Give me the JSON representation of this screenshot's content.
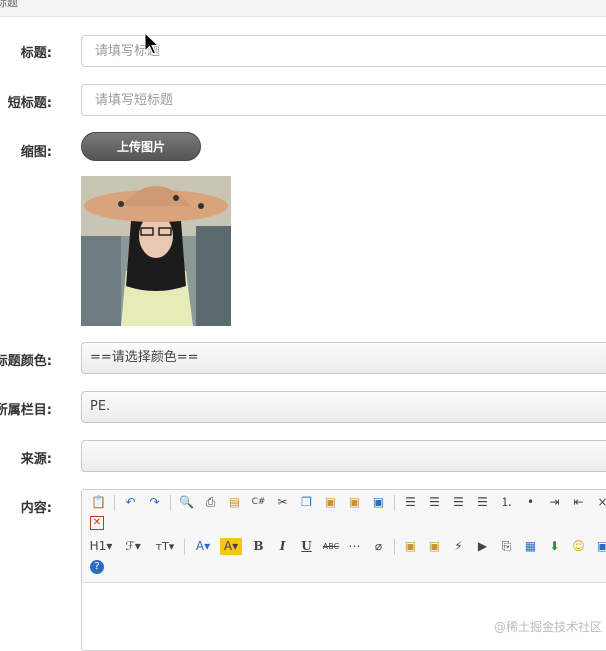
{
  "header": {
    "partial_text": "标题"
  },
  "form": {
    "title": {
      "label": "标题:",
      "placeholder": "请填写标题"
    },
    "short_title": {
      "label": "短标题:",
      "placeholder": "请填写短标题"
    },
    "thumbnail": {
      "label": "缩图:",
      "upload_label": "上传图片"
    },
    "title_color": {
      "label": "标题颜色:",
      "value": "==请选择颜色=="
    },
    "category": {
      "label": "所属栏目:",
      "value": "PE."
    },
    "source": {
      "label": "来源:",
      "value": ""
    },
    "content": {
      "label": "内容:"
    }
  },
  "editor": {
    "icons": [
      "paste-icon",
      "undo-icon",
      "redo-icon",
      "preview-icon",
      "print-icon",
      "template-icon",
      "code-icon",
      "cut-icon",
      "copy-icon",
      "paste-text-icon",
      "paste-word-icon",
      "paste-plain-icon",
      "align-left-icon",
      "align-center-icon",
      "align-right-icon",
      "justify-icon",
      "ordered-list-icon",
      "unordered-list-icon",
      "indent-icon",
      "outdent-icon",
      "fullscreen-icon",
      "heading-icon",
      "font-family-icon",
      "font-size-icon",
      "font-color-icon",
      "highlight-icon",
      "bold-icon",
      "italic-icon",
      "underline-icon",
      "strikethrough-icon",
      "hr-icon",
      "clear-format-icon",
      "image-icon",
      "multi-image-icon",
      "flash-icon",
      "media-icon",
      "attachment-icon",
      "table-icon",
      "insert-icon",
      "emoticon-icon",
      "map-icon",
      "help-icon"
    ],
    "glyphs": {
      "h1": "H1▾",
      "font": "ℱ▾",
      "size": "тT▾",
      "color": "A▾",
      "bg": "A▾",
      "bold": "B",
      "italic": "I",
      "underline": "U",
      "strike": "ABC",
      "close": "×"
    }
  },
  "watermark": "@稀土掘金技术社区",
  "colors": {
    "upload_button": "#5e5e5e",
    "border": "#cfcfcf",
    "highlight": "#f5c518",
    "link_blue": "#2b6cc4"
  }
}
